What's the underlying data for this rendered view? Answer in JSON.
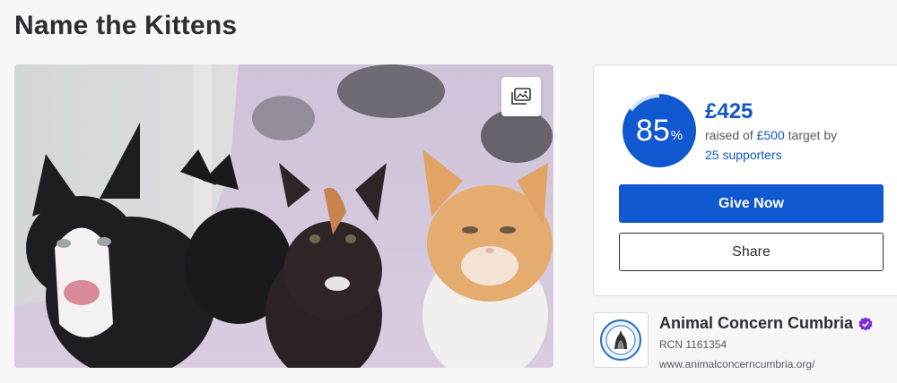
{
  "page": {
    "title": "Name the Kittens"
  },
  "hero": {
    "gallery_icon": "image-gallery-icon"
  },
  "donation": {
    "percent": "85",
    "percent_sign": "%",
    "percent_value": 0.85,
    "amount_raised": "£425",
    "raised_prefix": "raised of",
    "target": "£500",
    "raised_suffix": "target by",
    "supporters": "25 supporters",
    "give_label": "Give Now",
    "share_label": "Share",
    "accent_color": "#0f58cf"
  },
  "charity": {
    "name": "Animal Concern Cumbria",
    "rcn": "RCN 1161354",
    "url": "www.animalconcerncumbria.org/",
    "verified_icon": "verified-badge-icon",
    "verified_color": "#7b2fd6"
  }
}
